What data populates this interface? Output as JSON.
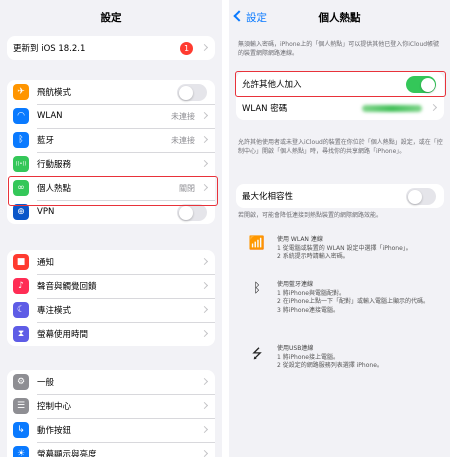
{
  "colors": {
    "accent": "#0a7aff",
    "switch_on": "#34c759",
    "highlight": "#e8323a",
    "badge": "#ff3b30"
  },
  "left": {
    "title": "設定",
    "update": {
      "label": "更新到 iOS 18.2.1",
      "badge": "1"
    },
    "connectivity": [
      {
        "label": "飛航模式",
        "icon": "airplane-icon",
        "color": "#ff9500",
        "glyph": "✈",
        "toggle": false
      },
      {
        "label": "WLAN",
        "icon": "wifi-icon",
        "color": "#0a7aff",
        "glyph": "◠",
        "value": "未連接"
      },
      {
        "label": "藍牙",
        "icon": "bluetooth-icon",
        "color": "#0a7aff",
        "glyph": "ᛒ",
        "value": "未連接"
      },
      {
        "label": "行動服務",
        "icon": "cellular-icon",
        "color": "#34c759",
        "glyph": "((•))"
      },
      {
        "label": "個人熱點",
        "icon": "hotspot-icon",
        "color": "#34c759",
        "glyph": "∞",
        "value": "關閉"
      },
      {
        "label": "VPN",
        "icon": "vpn-icon",
        "color": "#0a56c9",
        "glyph": "⊕",
        "toggle": false
      }
    ],
    "notifications": [
      {
        "label": "通知",
        "icon": "notifications-icon",
        "color": "#ff3b30",
        "glyph": "■"
      },
      {
        "label": "聲音與觸覺回饋",
        "icon": "sound-icon",
        "color": "#ff2d55",
        "glyph": "♪"
      },
      {
        "label": "專注模式",
        "icon": "focus-icon",
        "color": "#5e5ce6",
        "glyph": "☾"
      },
      {
        "label": "螢幕使用時間",
        "icon": "screen-time-icon",
        "color": "#5e5ce6",
        "glyph": "⧗"
      }
    ],
    "general": [
      {
        "label": "一般",
        "icon": "gear-icon",
        "color": "#8e8e93",
        "glyph": "⚙"
      },
      {
        "label": "控制中心",
        "icon": "control-center-icon",
        "color": "#8e8e93",
        "glyph": "☰"
      },
      {
        "label": "動作按鈕",
        "icon": "action-button-icon",
        "color": "#0a7aff",
        "glyph": "↳"
      },
      {
        "label": "螢幕顯示與亮度",
        "icon": "display-icon",
        "color": "#0a7aff",
        "glyph": "☀"
      }
    ]
  },
  "right": {
    "back_label": "設定",
    "title": "個人熱點",
    "intro": "無須輸入密碼，iPhone上的「個人熱點」可以提供其他已登入你iCloud帳號的裝置網際網路連線。",
    "allow_label": "允許其他人加入",
    "allow_on": true,
    "password_label": "WLAN 密碼",
    "allow_note": "允許其他使用者或未登入iCloud的裝置在你位於「個人熱點」設定，或在「控制中心」開啟「個人熱點」時，尋找你的共享網路「iPhone」。",
    "compat_label": "最大化相容性",
    "compat_on": false,
    "compat_note": "若開啟，可能會降低連接到熱點裝置的網際網路效能。",
    "methods": [
      {
        "icon": "wifi-icon",
        "glyph": "📶",
        "title": "使用 WLAN 連線",
        "steps": [
          "1 從電腦或裝置的 WLAN 設定中選擇「iPhone」。",
          "2 系統提示時請輸入密碼。"
        ]
      },
      {
        "icon": "bluetooth-icon",
        "glyph": "ᛒ",
        "title": "使用藍牙連線",
        "steps": [
          "1 將iPhone與電腦配對。",
          "2 在iPhone上點一下「配對」或輸入電腦上顯示的代碼。",
          "3 將iPhone連接電腦。"
        ]
      },
      {
        "icon": "usb-icon",
        "glyph": "⭍",
        "title": "使用USB連線",
        "steps": [
          "1 將iPhone接上電腦。",
          "2 從設定的網路服務列表選擇 iPhone。"
        ]
      }
    ]
  }
}
